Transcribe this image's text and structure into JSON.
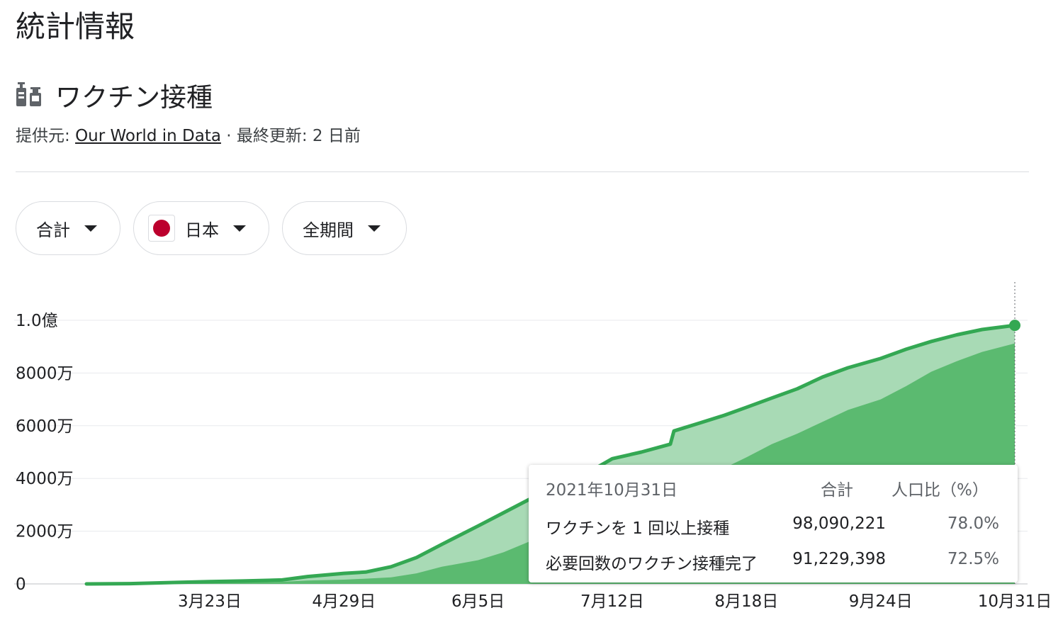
{
  "page_title": "統計情報",
  "section": {
    "icon": "vaccine-vial-icon",
    "title": "ワクチン接種",
    "source_prefix": "提供元: ",
    "source_link": "Our World in Data",
    "source_suffix": " · 最終更新: 2 日前"
  },
  "filters": {
    "measure": "合計",
    "country": "日本",
    "period": "全期間"
  },
  "colors": {
    "accent": "#34a853",
    "full_area": "#5bba70",
    "partial_area": "#a8dab5",
    "flag_red": "#bc002d"
  },
  "tooltip": {
    "date": "2021年10月31日",
    "header_total": "合計",
    "header_pct": "人口比（%）",
    "rows": [
      {
        "name": "ワクチンを 1 回以上接種",
        "value": "98,090,221",
        "pct": "78.0%"
      },
      {
        "name": "必要回数のワクチン接種完了",
        "value": "91,229,398",
        "pct": "72.5%"
      }
    ]
  },
  "chart_data": {
    "type": "area",
    "x_unit": "date",
    "x": [
      "2021-02-17",
      "2021-03-01",
      "2021-03-15",
      "2021-03-23",
      "2021-04-01",
      "2021-04-12",
      "2021-04-19",
      "2021-04-29",
      "2021-05-05",
      "2021-05-12",
      "2021-05-19",
      "2021-05-26",
      "2021-06-05",
      "2021-06-12",
      "2021-06-19",
      "2021-06-26",
      "2021-07-05",
      "2021-07-12",
      "2021-07-20",
      "2021-07-28",
      "2021-07-29",
      "2021-08-05",
      "2021-08-12",
      "2021-08-18",
      "2021-08-25",
      "2021-09-01",
      "2021-09-08",
      "2021-09-15",
      "2021-09-24",
      "2021-10-01",
      "2021-10-08",
      "2021-10-15",
      "2021-10-22",
      "2021-10-31"
    ],
    "series": [
      {
        "name": "ワクチンを 1 回以上接種",
        "values": [
          0.0,
          0.1,
          0.6,
          0.9,
          1.1,
          1.5,
          2.8,
          4.0,
          4.5,
          6.5,
          10.0,
          15.0,
          22.0,
          27.0,
          32.0,
          37.5,
          42.0,
          47.5,
          50.0,
          53.0,
          58.0,
          61.0,
          64.0,
          67.0,
          70.5,
          74.0,
          78.5,
          82.0,
          85.5,
          89.0,
          92.0,
          94.5,
          96.5,
          98.09
        ]
      },
      {
        "name": "必要回数のワクチン接種完了",
        "values": [
          0.0,
          0.0,
          0.2,
          0.4,
          0.6,
          0.8,
          1.3,
          1.6,
          2.0,
          2.5,
          4.0,
          6.5,
          9.0,
          12.0,
          16.0,
          21.0,
          24.0,
          28.0,
          31.5,
          33.5,
          34.5,
          40.0,
          44.0,
          48.0,
          53.0,
          57.0,
          61.5,
          66.0,
          70.0,
          75.0,
          80.5,
          84.5,
          88.0,
          91.23
        ]
      }
    ],
    "y_unit": "百万",
    "ylim": [
      0,
      100
    ],
    "y_ticks": [
      0,
      20,
      40,
      60,
      80,
      100
    ],
    "y_tick_labels": [
      "0",
      "2000万",
      "4000万",
      "6000万",
      "8000万",
      "1.0億"
    ],
    "x_ticks": [
      "2021-03-23",
      "2021-04-29",
      "2021-06-05",
      "2021-07-12",
      "2021-08-18",
      "2021-09-24",
      "2021-10-31"
    ],
    "x_tick_labels": [
      "3月23日",
      "4月29日",
      "6月5日",
      "7月12日",
      "8月18日",
      "9月24日",
      "10月31日"
    ],
    "grid": true
  }
}
